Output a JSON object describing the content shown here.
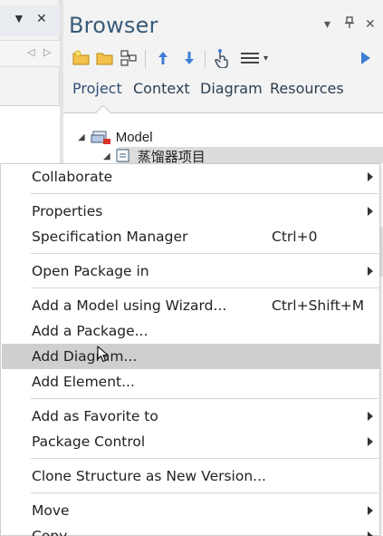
{
  "left_panel": {
    "dropdown_glyph": "▼",
    "close_glyph": "✕",
    "prev_glyph": "◁",
    "next_glyph": "▷"
  },
  "browser": {
    "title": "Browser",
    "dropdown_glyph": "▾",
    "pin_glyph": "ᵖ",
    "close_glyph": "✕",
    "toolbar": {
      "icons": [
        "new-package-icon",
        "folder-icon",
        "structure-icon",
        "move-up-icon",
        "move-down-icon",
        "touch-icon",
        "menu-icon",
        "play-icon"
      ],
      "dropdown_glyph": "▾"
    },
    "tabs": [
      "Project",
      "Context",
      "Diagram",
      "Resources"
    ],
    "active_tab": "Project",
    "tree": {
      "root_label": "Model",
      "child_label": "蒸馏器项目"
    }
  },
  "context_menu": {
    "items": {
      "collaborate": "Collaborate",
      "properties": "Properties",
      "spec_manager": "Specification Manager",
      "spec_manager_shortcut": "Ctrl+0",
      "open_package_in": "Open Package in",
      "add_model_wizard": "Add a Model using Wizard...",
      "add_model_wizard_shortcut": "Ctrl+Shift+M",
      "add_package": "Add a Package...",
      "add_diagram": "Add Diagram...",
      "add_element": "Add Element...",
      "add_favorite": "Add as Favorite to",
      "package_control": "Package Control",
      "clone_structure": "Clone Structure as New Version...",
      "move": "Move",
      "copy": "Copy"
    },
    "highlighted": "Add Diagram..."
  },
  "colors": {
    "title_blue": "#3b5c7a",
    "highlight_gray": "#cfcfcf",
    "play_blue": "#3d7fd6"
  }
}
